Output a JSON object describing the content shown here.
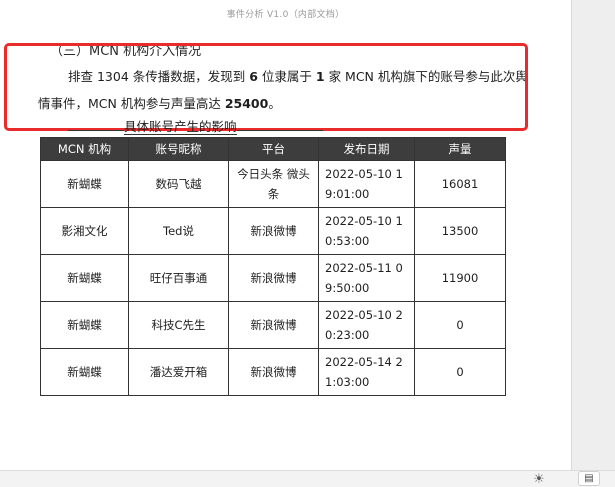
{
  "header": {
    "doc_title": "事件分析 V1.0（内部文档）"
  },
  "section": {
    "heading": "（三）MCN 机构介入情况",
    "para_part1": "排查 1304 条传播数据，发现到 ",
    "para_num1": "6",
    "para_part2": " 位隶属于 ",
    "para_num2": "1",
    "para_part3": " 家 MCN 机构旗下的账号参与此次舆情事件，MCN 机构参与声量高达 ",
    "para_num3": "25400",
    "para_end": "。"
  },
  "caption": {
    "text": "具体账号产生的影响"
  },
  "table": {
    "headers": [
      "MCN 机构",
      "账号昵称",
      "平台",
      "发布日期",
      "声量"
    ],
    "rows": [
      {
        "org": "新蝴蝶",
        "account": "数码飞越",
        "platform": "今日头条 微头条",
        "date": "2022-05-10 19:01:00",
        "volume": "16081"
      },
      {
        "org": "影湘文化",
        "account": "Ted说",
        "platform": "新浪微博",
        "date": "2022-05-10 10:53:00",
        "volume": "13500"
      },
      {
        "org": "新蝴蝶",
        "account": "旺仔百事通",
        "platform": "新浪微博",
        "date": "2022-05-11 09:50:00",
        "volume": "11900"
      },
      {
        "org": "新蝴蝶",
        "account": "科技C先生",
        "platform": "新浪微博",
        "date": "2022-05-10 20:23:00",
        "volume": "0"
      },
      {
        "org": "新蝴蝶",
        "account": "潘达爱开箱",
        "platform": "新浪微博",
        "date": "2022-05-14 21:03:00",
        "volume": "0"
      }
    ]
  },
  "statusbar": {
    "sun_icon": "☀",
    "doc_icon": "▤"
  },
  "colors": {
    "highlight_border": "#ea2b2b",
    "table_header_bg": "#3d3d3d"
  }
}
